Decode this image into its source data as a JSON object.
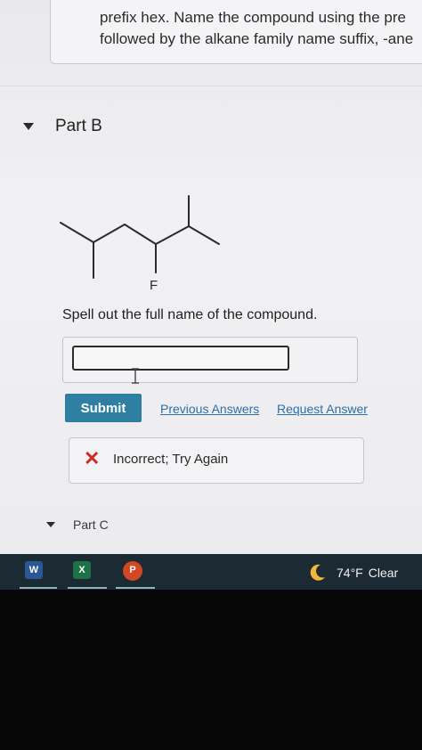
{
  "previous_part": {
    "line1": "prefix hex. Name the compound using the pre",
    "line2": "followed by the alkane family name suffix, -ane"
  },
  "part_b": {
    "title": "Part B",
    "structure_label": "F",
    "prompt": "Spell out the full name of the compound.",
    "answer_value": "",
    "submit_label": "Submit",
    "previous_answers_label": "Previous Answers",
    "request_answer_label": "Request Answer",
    "feedback_icon": "x-icon",
    "feedback_text": "Incorrect; Try Again"
  },
  "part_c": {
    "title": "Part C"
  },
  "taskbar": {
    "apps": [
      {
        "name": "word",
        "glyph": "W"
      },
      {
        "name": "excel",
        "glyph": "X"
      },
      {
        "name": "powerpoint",
        "glyph": "P"
      }
    ],
    "weather_icon": "moon-icon",
    "temperature": "74°F",
    "condition": "Clear"
  },
  "colors": {
    "submit": "#2f7fa3",
    "link": "#2d6fa8",
    "error": "#cc2b26",
    "taskbar": "#1c2a33"
  }
}
